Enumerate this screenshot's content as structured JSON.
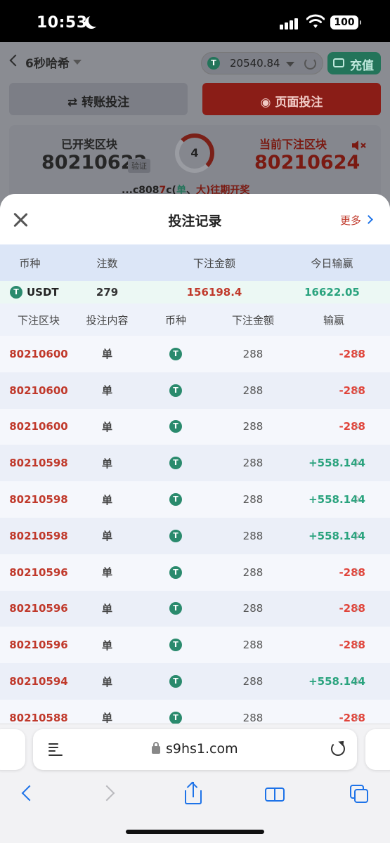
{
  "status_bar": {
    "time": "10:53",
    "battery": "100"
  },
  "app": {
    "game_title": "6秒哈希",
    "balance": "20540.84",
    "currency_icon": "T",
    "recharge_label": "充值",
    "transfer_bet_label": "转账投注",
    "page_bet_label": "页面投注",
    "opened_block_label": "已开奖区块",
    "opened_block_number": "80210622",
    "verify_label": "验证",
    "countdown": "4",
    "current_block_label": "当前下注区块",
    "current_block_number": "80210624",
    "hash_prefix": "...c808",
    "hash_digit": "7",
    "hash_mid": "c(",
    "hash_result_odd": "单",
    "hash_sep": "、",
    "hash_result_big": "大",
    "hash_suffix": ")往期开奖",
    "colors": {
      "primary_red": "#c0392b",
      "positive_green": "#2aa37e",
      "tether_green": "#2a8a6d"
    }
  },
  "modal": {
    "title": "投注记录",
    "more_label": "更多",
    "summary_headers": [
      "币种",
      "注数",
      "下注金额",
      "今日输赢"
    ],
    "summary": {
      "currency": "USDT",
      "count": "279",
      "amount": "156198.4",
      "today_pl": "16622.05"
    },
    "record_headers": [
      "下注区块",
      "投注内容",
      "币种",
      "下注金额",
      "输赢"
    ],
    "records": [
      {
        "block": "80210600",
        "content": "单",
        "amount": "288",
        "result": "-288",
        "win": false
      },
      {
        "block": "80210600",
        "content": "单",
        "amount": "288",
        "result": "-288",
        "win": false
      },
      {
        "block": "80210600",
        "content": "单",
        "amount": "288",
        "result": "-288",
        "win": false
      },
      {
        "block": "80210598",
        "content": "单",
        "amount": "288",
        "result": "+558.144",
        "win": true
      },
      {
        "block": "80210598",
        "content": "单",
        "amount": "288",
        "result": "+558.144",
        "win": true
      },
      {
        "block": "80210598",
        "content": "单",
        "amount": "288",
        "result": "+558.144",
        "win": true
      },
      {
        "block": "80210596",
        "content": "单",
        "amount": "288",
        "result": "-288",
        "win": false
      },
      {
        "block": "80210596",
        "content": "单",
        "amount": "288",
        "result": "-288",
        "win": false
      },
      {
        "block": "80210596",
        "content": "单",
        "amount": "288",
        "result": "-288",
        "win": false
      },
      {
        "block": "80210594",
        "content": "单",
        "amount": "288",
        "result": "+558.144",
        "win": true
      },
      {
        "block": "80210588",
        "content": "单",
        "amount": "288",
        "result": "-288",
        "win": false
      }
    ]
  },
  "browser": {
    "url": "s9hs1.com"
  }
}
